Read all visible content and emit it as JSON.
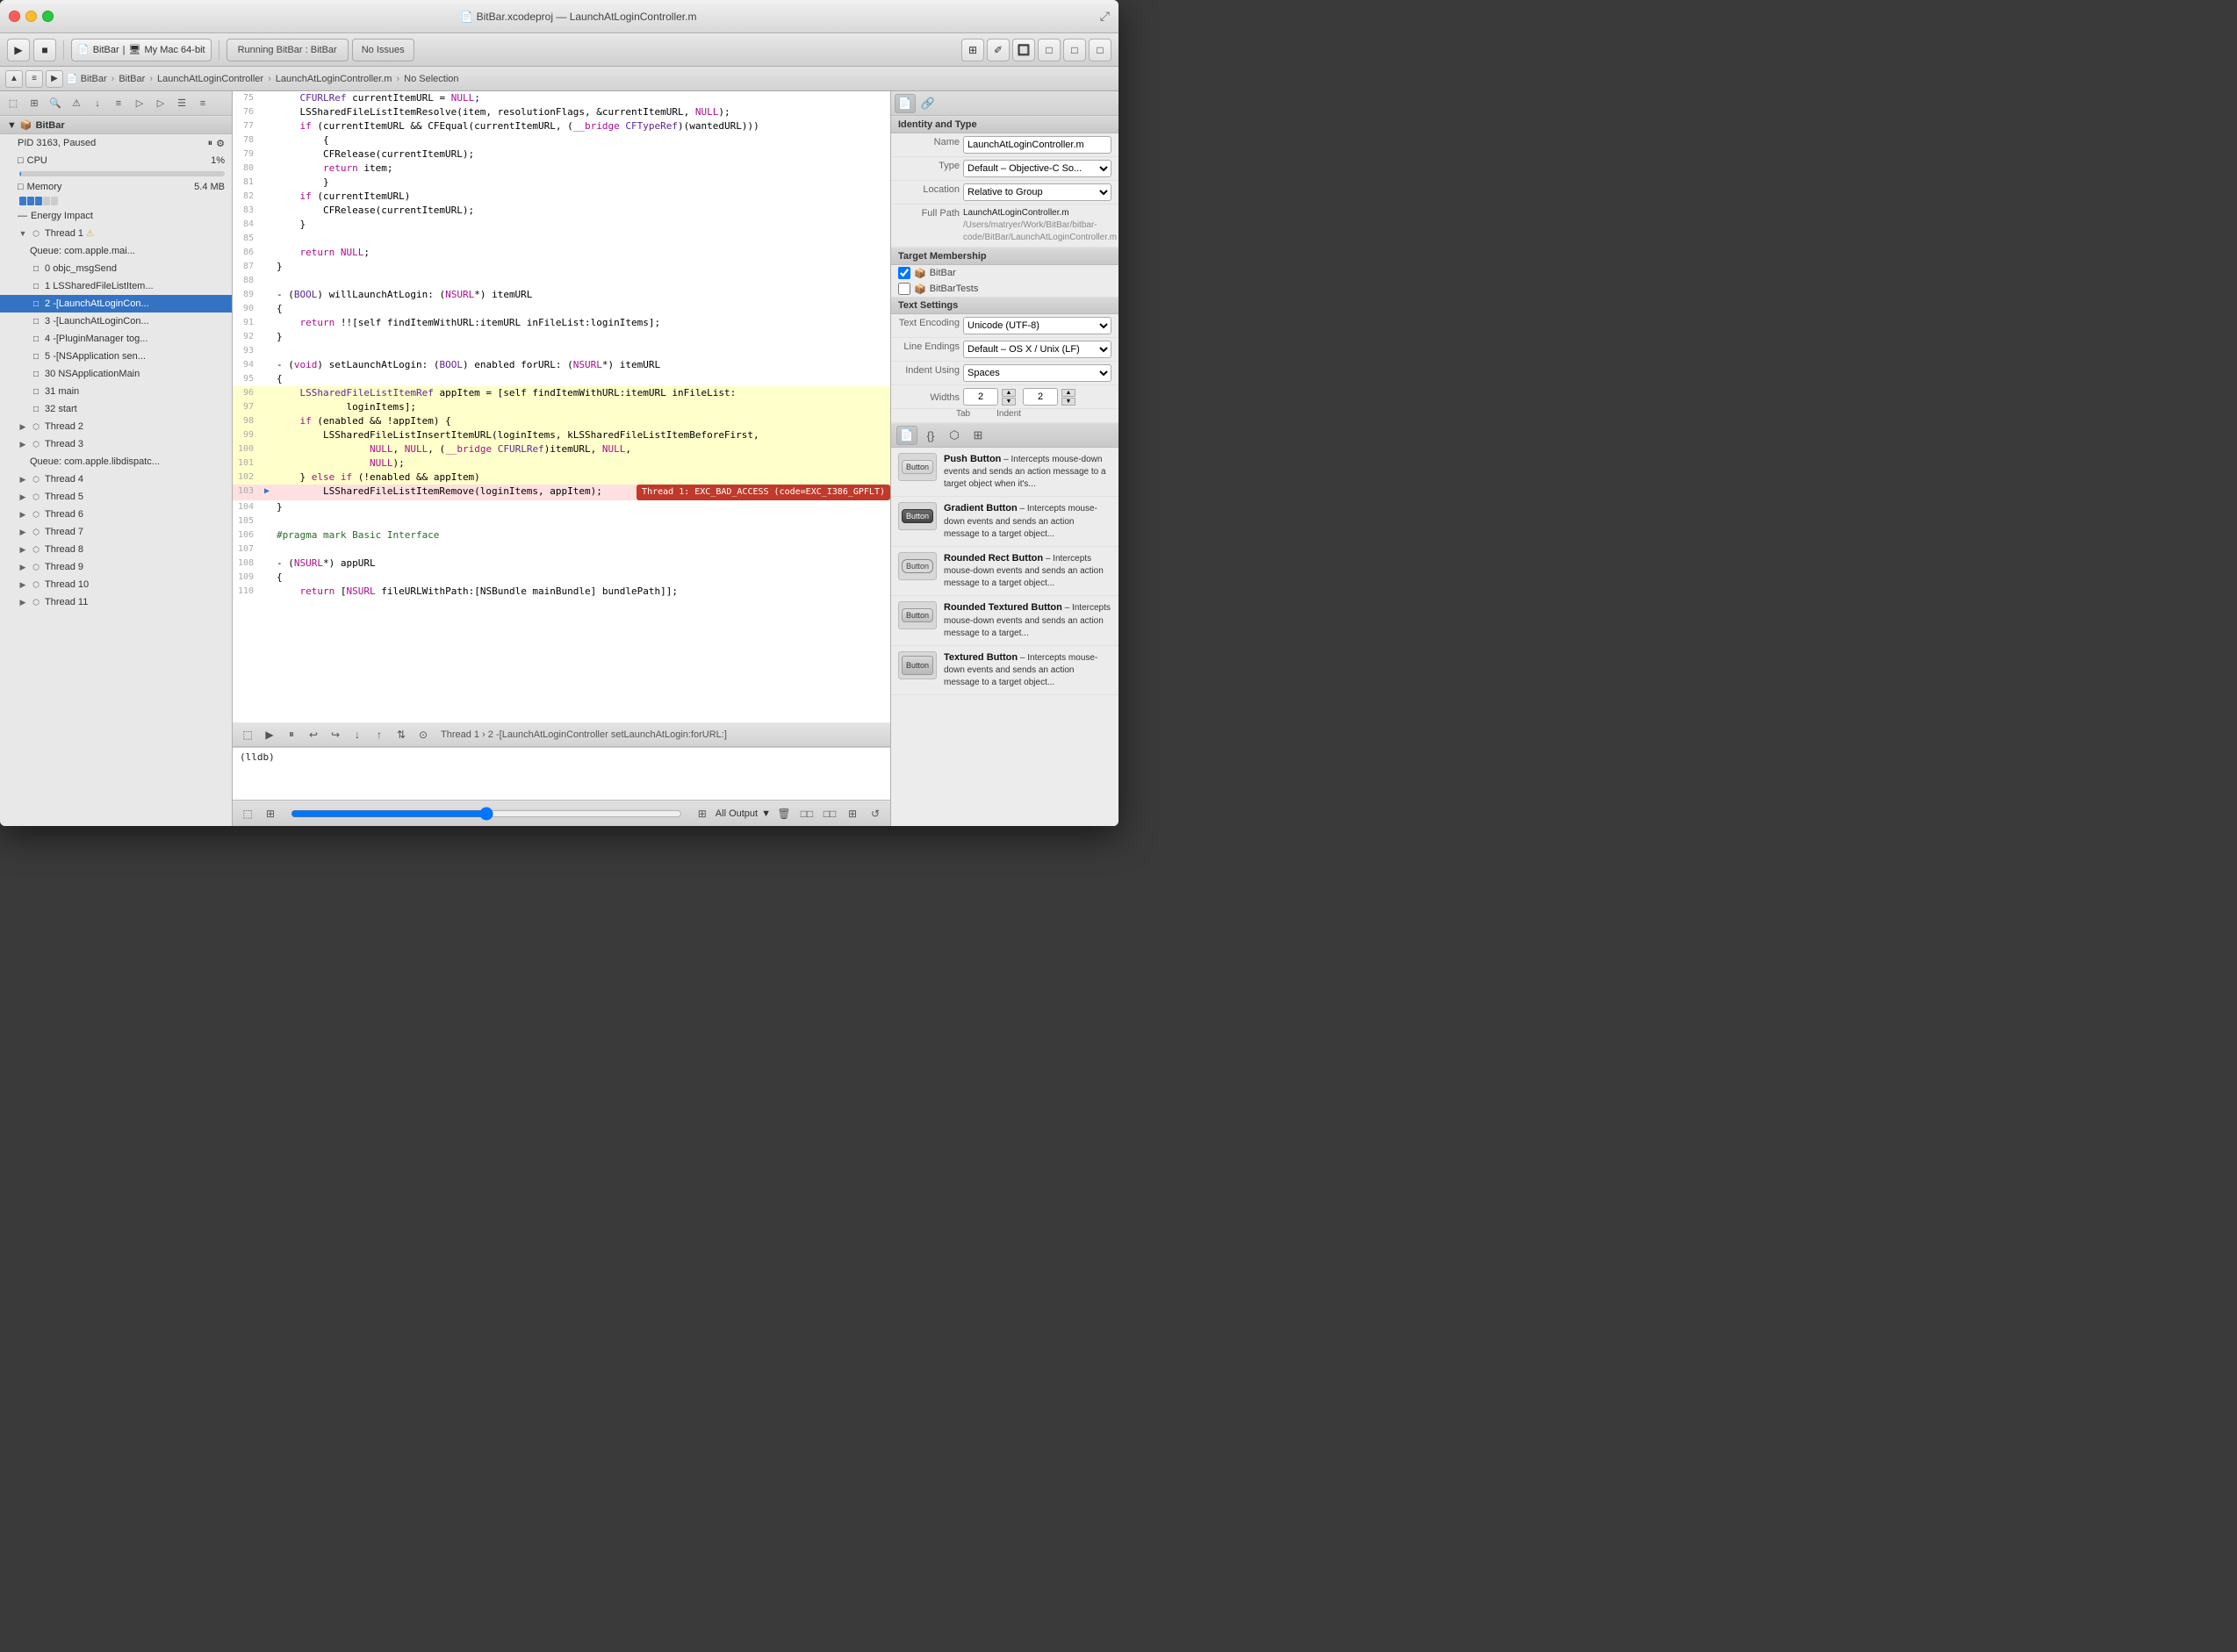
{
  "window": {
    "title": "BitBar.xcodeproj — LaunchAtLoginController.m"
  },
  "titlebar": {
    "file_icon": "📄",
    "project_name": "BitBar.xcodeproj",
    "separator": "—",
    "file_name": "LaunchAtLoginController.m",
    "expand_btn": "⤢"
  },
  "toolbar": {
    "run_btn": "▶",
    "stop_btn": "■",
    "scheme_icon": "📄",
    "scheme_name": "BitBar",
    "separator": "|",
    "device_icon": "🖥",
    "device_name": "My Mac 64-bit",
    "run_status": "Running BitBar : BitBar",
    "no_issues": "No Issues",
    "right_btns": [
      "⊞",
      "✐",
      "🔲",
      "□",
      "□",
      "□"
    ]
  },
  "nav_bar": {
    "back_btn": "◀",
    "forward_btn": "▶",
    "breadcrumbs": [
      "BitBar",
      "BitBar",
      "LaunchAtLoginController",
      "LaunchAtLoginController.m",
      "No Selection"
    ],
    "file_icon": "📄"
  },
  "left_panel": {
    "toolbar_btns": [
      "⬚",
      "⊞",
      "🔍",
      "⚠",
      "↓",
      "≡",
      "❯",
      "❯",
      "☰",
      "≡"
    ],
    "app_name": "BitBar",
    "app_pid": "PID 3163, Paused",
    "cpu_label": "CPU",
    "cpu_percent": "1%",
    "memory_label": "Memory",
    "memory_value": "5.4 MB",
    "energy_label": "Energy Impact",
    "threads": [
      {
        "id": 1,
        "name": "Thread 1",
        "queue": "Queue: com.apple.mai...",
        "has_warning": true,
        "expanded": true,
        "frames": [
          {
            "num": "0",
            "name": "objc_msgSend",
            "selected": false
          },
          {
            "num": "1",
            "name": "LSSharedFileListItem...",
            "selected": false
          },
          {
            "num": "2",
            "name": "-[LaunchAtLoginCon...",
            "selected": true
          },
          {
            "num": "3",
            "name": "-[LaunchAtLoginCon...",
            "selected": false
          },
          {
            "num": "4",
            "name": "-[PluginManager tog...",
            "selected": false
          },
          {
            "num": "5",
            "name": "-[NSApplication sen...",
            "selected": false
          },
          {
            "num": "30",
            "name": "NSApplicationMain",
            "selected": false
          },
          {
            "num": "31",
            "name": "main",
            "selected": false
          },
          {
            "num": "32",
            "name": "start",
            "selected": false
          }
        ]
      },
      {
        "id": 2,
        "name": "Thread 2",
        "expanded": false
      },
      {
        "id": 3,
        "name": "Thread 3",
        "queue": "Queue: com.apple.libdispatc...",
        "expanded": false
      },
      {
        "id": 4,
        "name": "Thread 4",
        "expanded": false
      },
      {
        "id": 5,
        "name": "Thread 5",
        "expanded": false
      },
      {
        "id": 6,
        "name": "Thread 6",
        "expanded": false
      },
      {
        "id": 7,
        "name": "Thread 7",
        "expanded": false
      },
      {
        "id": 8,
        "name": "Thread 8",
        "expanded": false
      },
      {
        "id": 9,
        "name": "Thread 9",
        "expanded": false
      },
      {
        "id": 10,
        "name": "Thread 10",
        "expanded": false
      },
      {
        "id": 11,
        "name": "Thread 11",
        "expanded": false
      }
    ]
  },
  "code_editor": {
    "lines": [
      {
        "num": 75,
        "content": "    CFURLRef currentItemURL = NULL;",
        "type": "normal"
      },
      {
        "num": 76,
        "content": "    LSSharedFileListItemResolve(item, resolutionFlags, &currentItemURL, NULL);",
        "type": "normal"
      },
      {
        "num": 77,
        "content": "    if (currentItemURL && CFEqual(currentItemURL, (__bridge CFTypeRef)(wantedURL)))",
        "type": "normal"
      },
      {
        "num": 78,
        "content": "        {",
        "type": "normal"
      },
      {
        "num": 79,
        "content": "        CFRelease(currentItemURL);",
        "type": "normal"
      },
      {
        "num": 80,
        "content": "        return item;",
        "type": "normal"
      },
      {
        "num": 81,
        "content": "        }",
        "type": "normal"
      },
      {
        "num": 82,
        "content": "    if (currentItemURL)",
        "type": "normal"
      },
      {
        "num": 83,
        "content": "        CFRelease(currentItemURL);",
        "type": "normal"
      },
      {
        "num": 84,
        "content": "    }",
        "type": "normal"
      },
      {
        "num": 85,
        "content": "",
        "type": "normal"
      },
      {
        "num": 86,
        "content": "    return NULL;",
        "type": "normal"
      },
      {
        "num": 87,
        "content": "}",
        "type": "normal"
      },
      {
        "num": 88,
        "content": "",
        "type": "normal"
      },
      {
        "num": 89,
        "content": "- (BOOL) willLaunchAtLogin: (NSURL*) itemURL",
        "type": "normal"
      },
      {
        "num": 90,
        "content": "{",
        "type": "normal"
      },
      {
        "num": 91,
        "content": "    return !![self findItemWithURL:itemURL inFileList:loginItems];",
        "type": "normal"
      },
      {
        "num": 92,
        "content": "}",
        "type": "normal"
      },
      {
        "num": 93,
        "content": "",
        "type": "normal"
      },
      {
        "num": 94,
        "content": "- (void) setLaunchAtLogin: (BOOL) enabled forURL: (NSURL*) itemURL",
        "type": "normal"
      },
      {
        "num": 95,
        "content": "{",
        "type": "normal"
      },
      {
        "num": 96,
        "content": "    LSSharedFileListItemRef appItem = [self findItemWithURL:itemURL inFileList:",
        "type": "normal"
      },
      {
        "num": 97,
        "content": "            loginItems];",
        "type": "normal"
      },
      {
        "num": 98,
        "content": "    if (enabled && !appItem) {",
        "type": "normal"
      },
      {
        "num": 99,
        "content": "        LSSharedFileListInsertItemURL(loginItems, kLSSharedFileListItemBeforeFirst,",
        "type": "normal"
      },
      {
        "num": 100,
        "content": "                NULL, NULL, (__bridge CFURLRef)itemURL, NULL,",
        "type": "normal"
      },
      {
        "num": 101,
        "content": "                NULL);",
        "type": "normal"
      },
      {
        "num": 102,
        "content": "    } else if (!enabled && appItem)",
        "type": "normal"
      },
      {
        "num": 103,
        "content": "        LSSharedFileListItemRemove(loginItems, appItem);",
        "type": "error",
        "arrow": true,
        "error_msg": "Thread 1: EXC_BAD_ACCESS (code=EXC_I386_GPFLT)"
      },
      {
        "num": 104,
        "content": "}",
        "type": "normal"
      },
      {
        "num": 105,
        "content": "",
        "type": "normal"
      },
      {
        "num": 106,
        "content": "#pragma mark Basic Interface",
        "type": "normal"
      },
      {
        "num": 107,
        "content": "",
        "type": "normal"
      },
      {
        "num": 108,
        "content": "- (NSURL*) appURL",
        "type": "normal"
      },
      {
        "num": 109,
        "content": "{",
        "type": "normal"
      },
      {
        "num": 110,
        "content": "    return [NSURL fileURLWithPath:[NSBundle mainBundle] bundlePath]];",
        "type": "normal"
      }
    ]
  },
  "debug_bar": {
    "btns": [
      "⬚",
      "▶",
      "⏸",
      "↩",
      "↪",
      "↓",
      "↑",
      "↑↓",
      "⊙"
    ],
    "breadcrumbs": [
      "Thread 1",
      "2 -[LaunchAtLoginController setLaunchAtLogin:forURL:]"
    ],
    "prompt": "(lldb)"
  },
  "right_panel": {
    "top_tabs": [
      {
        "icon": "📄",
        "active": true
      },
      {
        "icon": "🔗",
        "active": false
      }
    ],
    "identity_section": "Identity and Type",
    "name_label": "Name",
    "name_value": "LaunchAtLoginController.m",
    "type_label": "Type",
    "type_value": "Default – Objective-C So...",
    "location_label": "Location",
    "location_value": "Relative to Group",
    "full_path_label": "Full Path",
    "full_path_value": "/Users/matryer/Work/BitBar/bitbar-code/BitBar/LaunchAtLoginController.m",
    "target_section": "Target Membership",
    "targets": [
      {
        "name": "BitBar",
        "checked": true
      },
      {
        "name": "BitBarTests",
        "checked": false
      }
    ],
    "text_settings_section": "Text Settings",
    "encoding_label": "Text Encoding",
    "encoding_value": "Unicode (UTF-8)",
    "line_endings_label": "Line Endings",
    "line_endings_value": "Default – OS X / Unix (LF)",
    "indent_label": "Indent Using",
    "indent_value": "Spaces",
    "widths_label": "Widths",
    "tab_label": "Tab",
    "tab_value": "2",
    "indent_size_label": "Indent",
    "indent_size_value": "2",
    "widget_section_tabs": [
      "doc",
      "{}",
      "cube",
      "grid"
    ],
    "widgets": [
      {
        "name": "Push Button",
        "desc": "Push Button – Intercepts mouse-down events and sends an action message to a target object when it's..."
      },
      {
        "name": "Gradient Button",
        "desc": "Gradient Button – Intercepts mouse-down events and sends an action message to a target object..."
      },
      {
        "name": "Rounded Rect Button",
        "desc": "Rounded Rect Button – Intercepts mouse-down events and sends an action message to a target object..."
      },
      {
        "name": "Rounded Textured Button",
        "desc": "Rounded Textured Button – Intercepts mouse-down events and sends an action message to a target..."
      },
      {
        "name": "Textured Button",
        "desc": "Textured Button – Intercepts mouse-down events and sends an action message to a target object..."
      }
    ]
  },
  "bottom_bar": {
    "output_label": "All Output",
    "btns": [
      "🗑",
      "□□",
      "□□",
      "⊞",
      "↺"
    ]
  }
}
